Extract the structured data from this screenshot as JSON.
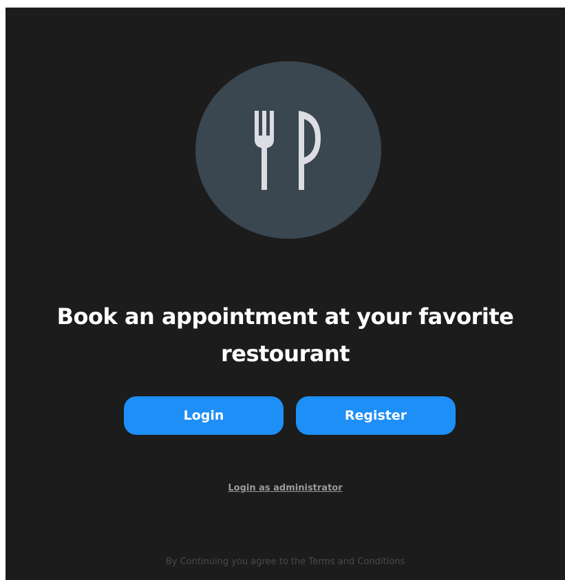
{
  "logo": {
    "icon": "fork-knife-icon",
    "circle_color": "#3a4650",
    "icon_color": "#dcdde3"
  },
  "headline": {
    "line1": "Book an appointment at your favorite",
    "line2": "restourant"
  },
  "actions": {
    "login_label": "Login",
    "register_label": "Register",
    "button_color": "#1e8ff7"
  },
  "admin": {
    "link_label": "Login as administrator"
  },
  "footer": {
    "terms_text": "By Continuing you agree to the Terms and Conditions"
  }
}
